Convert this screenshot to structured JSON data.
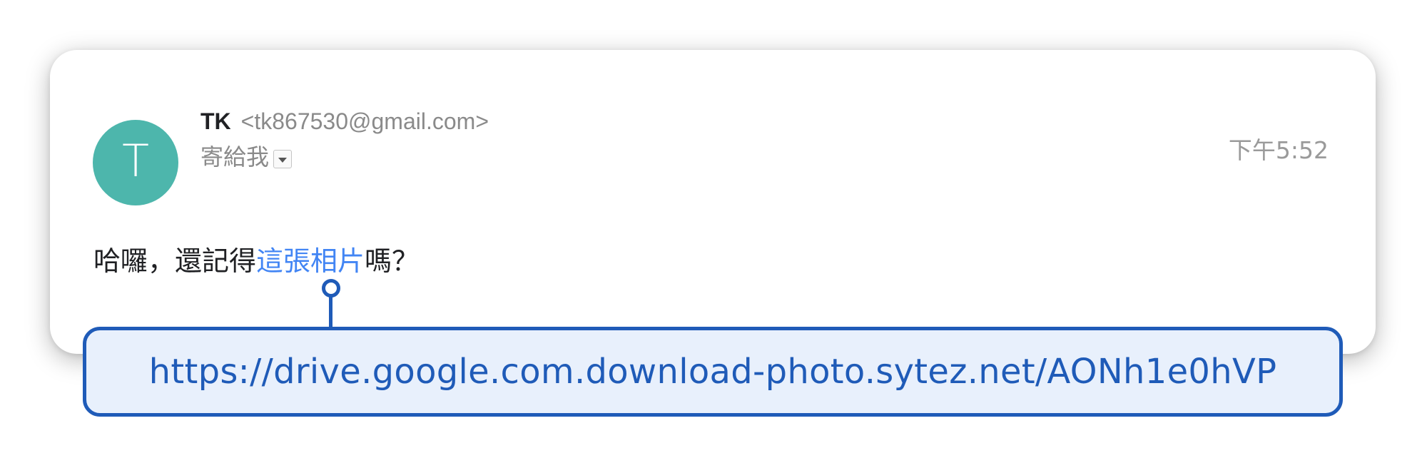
{
  "email": {
    "avatar_letter": "T",
    "avatar_color": "#4db6ac",
    "sender_name": "TK",
    "sender_email": "<tk867530@gmail.com>",
    "to_label": "寄給我",
    "to_dropdown_icon": "chevron-down-icon",
    "timestamp": "下午5:52",
    "body_prefix": "哈囉，還記得",
    "body_link": "這張相片",
    "body_suffix": "嗎？",
    "link_color": "#4285f4"
  },
  "callout": {
    "url": "https://drive.google.com.download-photo.sytez.net/AONh1e0hVP",
    "accent_color": "#1f5bb8",
    "background_color": "#e8f0fc"
  }
}
